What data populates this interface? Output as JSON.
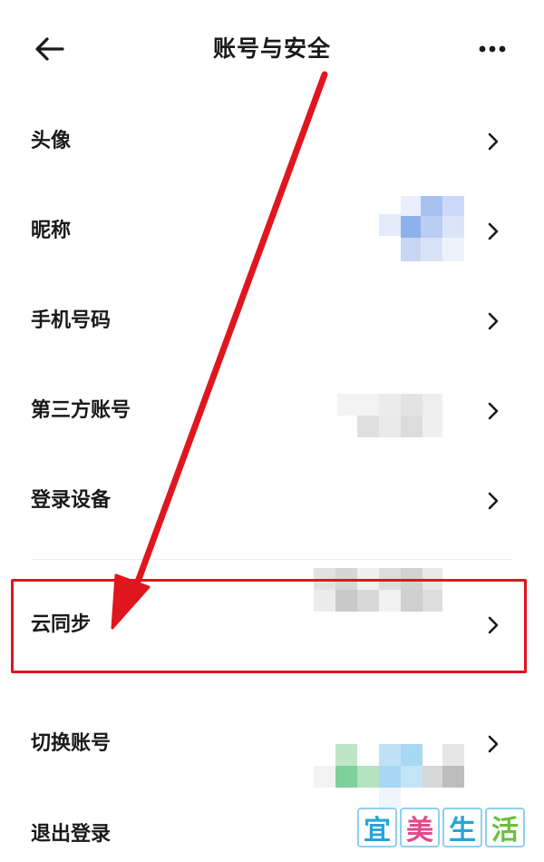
{
  "header": {
    "title": "账号与安全",
    "back_icon": "arrow-left-icon",
    "more_icon": "more-horizontal-icon"
  },
  "rows": [
    {
      "label": "头像",
      "value": "blurred avatar"
    },
    {
      "label": "昵称",
      "value": "blurred nickname"
    },
    {
      "label": "手机号码",
      "value": "blurred phone number"
    },
    {
      "label": "第三方账号",
      "value": "blurred accounts"
    },
    {
      "label": "登录设备"
    },
    {
      "label": "云同步",
      "highlighted": true
    },
    {
      "label": "切换账号"
    },
    {
      "label": "退出登录"
    }
  ],
  "annotation": {
    "highlight_color": "#e0161f",
    "arrow_color": "#e0161f"
  },
  "watermark": {
    "chars": [
      "宜",
      "美",
      "生",
      "活"
    ],
    "colors": [
      "#2aa3d9",
      "#e04a8c",
      "#2aa3d9",
      "#6abf3c"
    ]
  }
}
